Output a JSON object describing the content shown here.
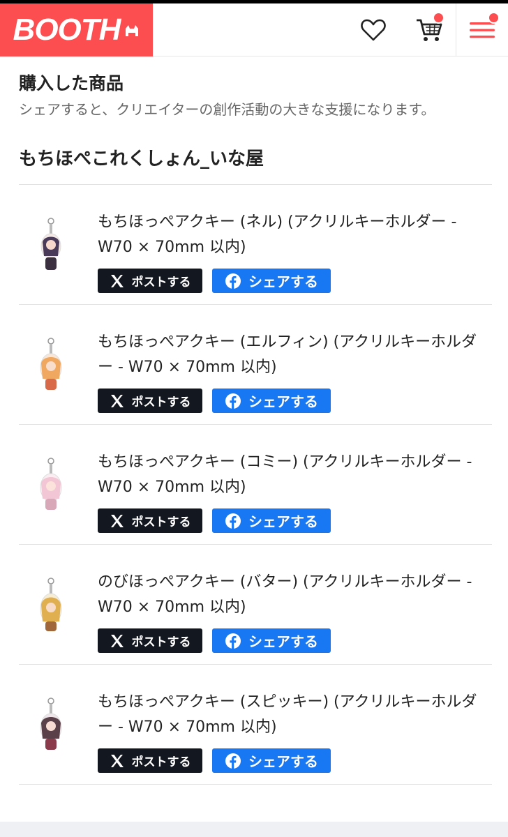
{
  "header": {
    "logo_text": "BOOTH",
    "brand_color": "#fc4d50",
    "icons": [
      "heart-icon",
      "cart-icon",
      "menu-icon"
    ]
  },
  "page": {
    "title": "購入した商品",
    "subtitle": "シェアすると、クリエイターの創作活動の大きな支援になります。"
  },
  "shop": {
    "name": "もちほぺこれくしょん_いな屋"
  },
  "share": {
    "x_label": "ポストする",
    "fb_label": "シェアする",
    "x_color": "#13171f",
    "fb_color": "#1877f2"
  },
  "items": [
    {
      "title": "もちほっぺアクキー (ネル) (アクリルキーホルダー - W70 × 70mm 以内)"
    },
    {
      "title": "もちほっぺアクキー (エルフィン) (アクリルキーホルダー - W70 × 70mm 以内)"
    },
    {
      "title": "もちほっぺアクキー (コミー) (アクリルキーホルダー - W70 × 70mm 以内)"
    },
    {
      "title": "のびほっぺアクキー (バター) (アクリルキーホルダー - W70 × 70mm 以内)"
    },
    {
      "title": "もちほっぺアクキー (スピッキー) (アクリルキーホルダー - W70 × 70mm 以内)"
    }
  ]
}
